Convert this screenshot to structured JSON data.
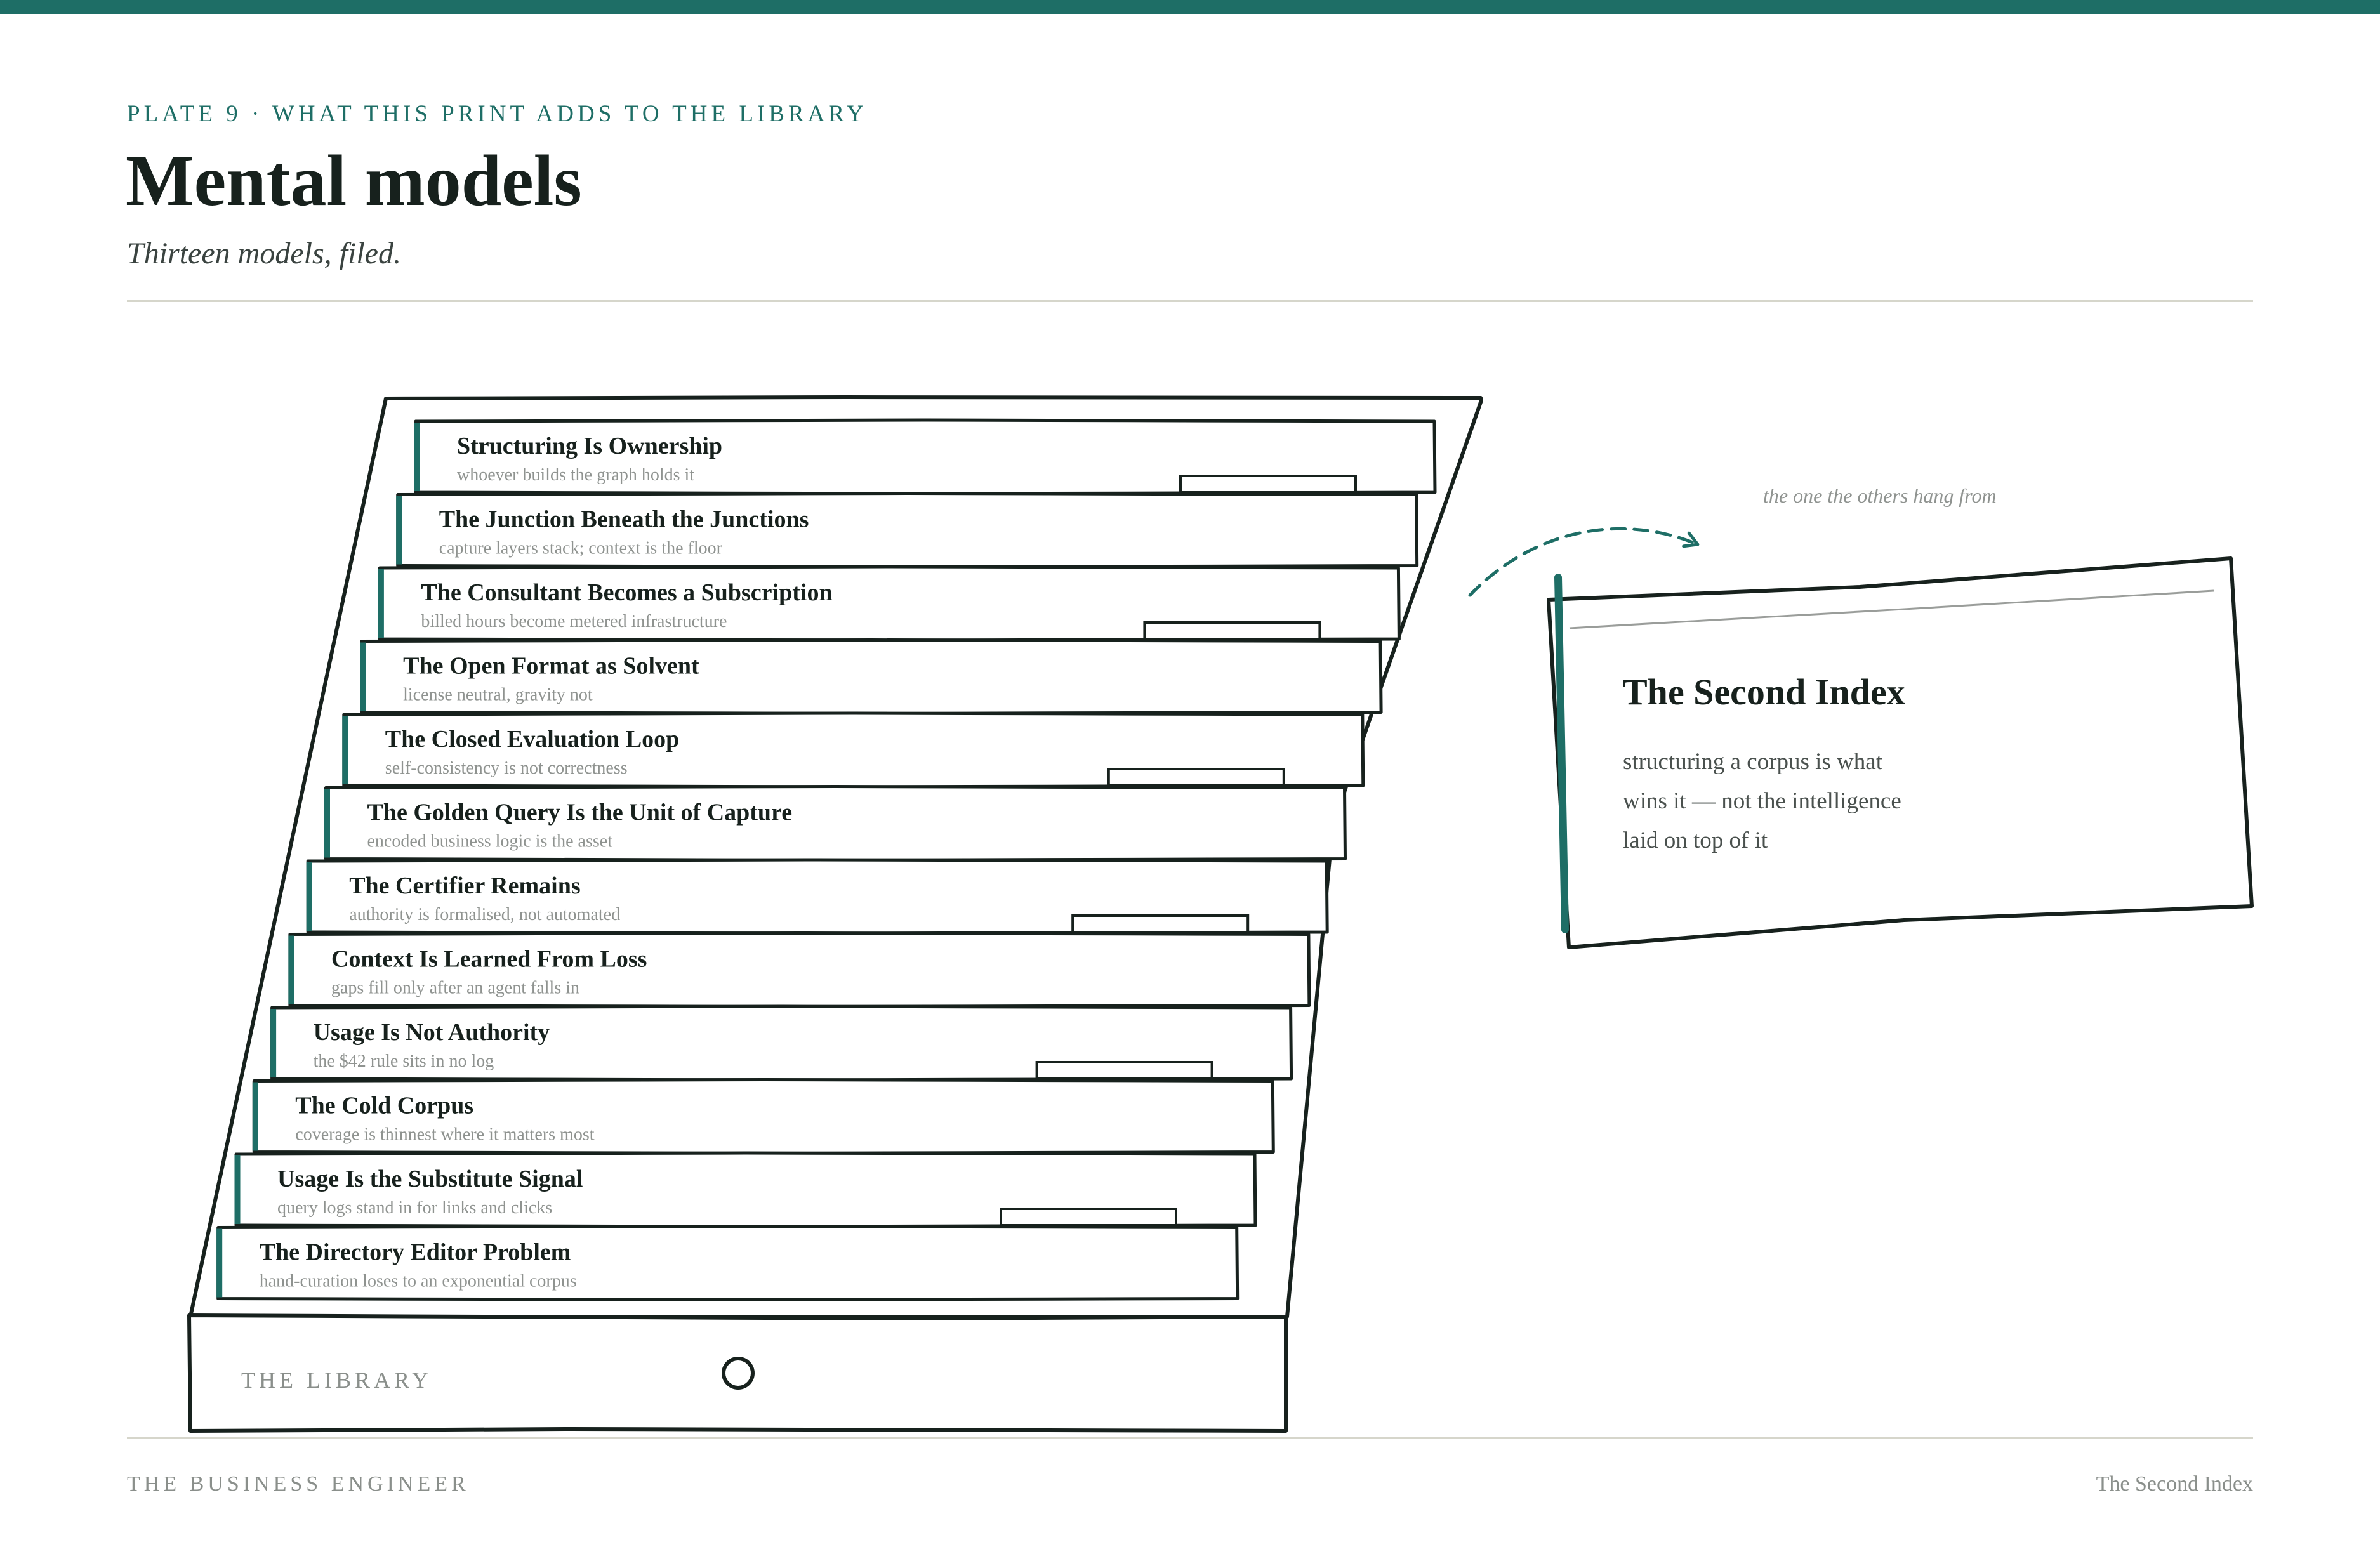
{
  "header": {
    "eyebrow": "PLATE 9 · WHAT THIS PRINT ADDS TO THE LIBRARY",
    "title": "Mental models",
    "subtitle": "Thirteen models, filed."
  },
  "library": {
    "label": "THE LIBRARY",
    "books": [
      {
        "title": "Structuring Is Ownership",
        "subtitle": "whoever builds the graph holds it"
      },
      {
        "title": "The Junction Beneath the Junctions",
        "subtitle": "capture layers stack; context is the floor"
      },
      {
        "title": "The Consultant Becomes a Subscription",
        "subtitle": "billed hours become metered infrastructure"
      },
      {
        "title": "The Open Format as Solvent",
        "subtitle": "license neutral, gravity not"
      },
      {
        "title": "The Closed Evaluation Loop",
        "subtitle": "self-consistency is not correctness"
      },
      {
        "title": "The Golden Query Is the Unit of Capture",
        "subtitle": "encoded business logic is the asset"
      },
      {
        "title": "The Certifier Remains",
        "subtitle": "authority is formalised, not automated"
      },
      {
        "title": "Context Is Learned From Loss",
        "subtitle": "gaps fill only after an agent falls in"
      },
      {
        "title": "Usage Is Not Authority",
        "subtitle": "the $42 rule sits in no log"
      },
      {
        "title": "The Cold Corpus",
        "subtitle": "coverage is thinnest where it matters most"
      },
      {
        "title": "Usage Is the Substitute Signal",
        "subtitle": "query logs stand in for links and clicks"
      },
      {
        "title": "The Directory Editor Problem",
        "subtitle": "hand-curation loses to an exponential corpus"
      }
    ]
  },
  "featured": {
    "annotation": "the one the others hang from",
    "title": "The Second Index",
    "body": [
      "structuring a corpus is what",
      "wins it — not the intelligence",
      "laid on top of it"
    ]
  },
  "footer": {
    "left": "THE BUSINESS ENGINEER",
    "right": "The Second Index"
  },
  "colors": {
    "accent": "#1e6e66",
    "ink": "#17211d",
    "muted": "#8f9390",
    "rule": "#d6d6cb"
  }
}
